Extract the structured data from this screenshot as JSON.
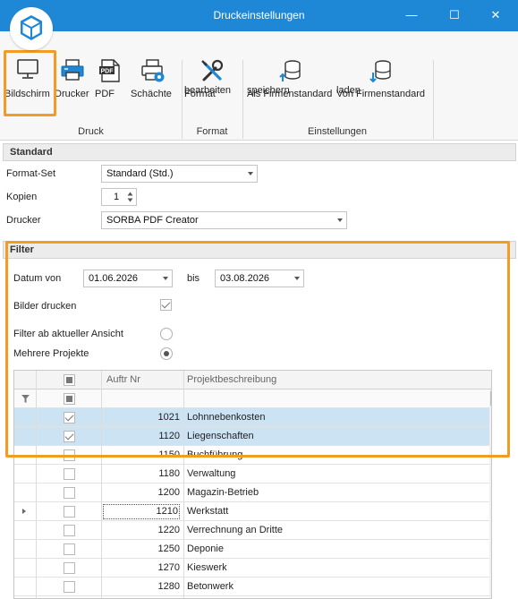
{
  "window": {
    "title": "Druckeinstellungen",
    "minimize": "—",
    "maximize": "☐",
    "close": "✕"
  },
  "ribbon": {
    "buttons": {
      "bildschirm": "Bildschirm",
      "drucker": "Drucker",
      "pdf": "PDF",
      "schaechte": "Schächte",
      "format_bearbeiten_1": "Format",
      "format_bearbeiten_2": "bearbeiten",
      "als_standard_1": "Als Firmenstandard",
      "als_standard_2": "speichern",
      "von_standard_1": "Von Firmenstandard",
      "von_standard_2": "laden"
    },
    "groups": {
      "druck": "Druck",
      "format": "Format",
      "einstellungen": "Einstellungen"
    },
    "pdf_icon_text": "PDF"
  },
  "standard": {
    "header": "Standard",
    "format_set_label": "Format-Set",
    "format_set_value": "Standard (Std.)",
    "kopien_label": "Kopien",
    "kopien_value": "1",
    "drucker_label": "Drucker",
    "drucker_value": "SORBA PDF Creator"
  },
  "filter": {
    "header": "Filter",
    "datum_von_label": "Datum von",
    "datum_von_value": "01.06.2026",
    "bis_label": "bis",
    "bis_value": "03.08.2026",
    "bilder_drucken_label": "Bilder drucken",
    "bilder_drucken_checked": true,
    "filter_ansicht_label": "Filter ab aktueller Ansicht",
    "mehrere_projekte_label": "Mehrere Projekte",
    "selected_option": "Mehrere Projekte"
  },
  "grid": {
    "columns": [
      "Auftr Nr",
      "Projektbeschreibung"
    ],
    "rows": [
      {
        "nr": "1021",
        "desc": "Lohnnebenkosten",
        "checked": true
      },
      {
        "nr": "1120",
        "desc": "Liegenschaften",
        "checked": true
      },
      {
        "nr": "1150",
        "desc": "Buchführung",
        "checked": false
      },
      {
        "nr": "1180",
        "desc": "Verwaltung",
        "checked": false
      },
      {
        "nr": "1200",
        "desc": "Magazin-Betrieb",
        "checked": false
      },
      {
        "nr": "1210",
        "desc": "Werkstatt",
        "checked": false
      },
      {
        "nr": "1220",
        "desc": "Verrechnung an Dritte",
        "checked": false
      },
      {
        "nr": "1250",
        "desc": "Deponie",
        "checked": false
      },
      {
        "nr": "1270",
        "desc": "Kieswerk",
        "checked": false
      },
      {
        "nr": "1280",
        "desc": "Betonwerk",
        "checked": false
      }
    ]
  },
  "colors": {
    "titlebar": "#1e88d6",
    "highlight": "#f39c23",
    "selection": "#cce3f4"
  }
}
